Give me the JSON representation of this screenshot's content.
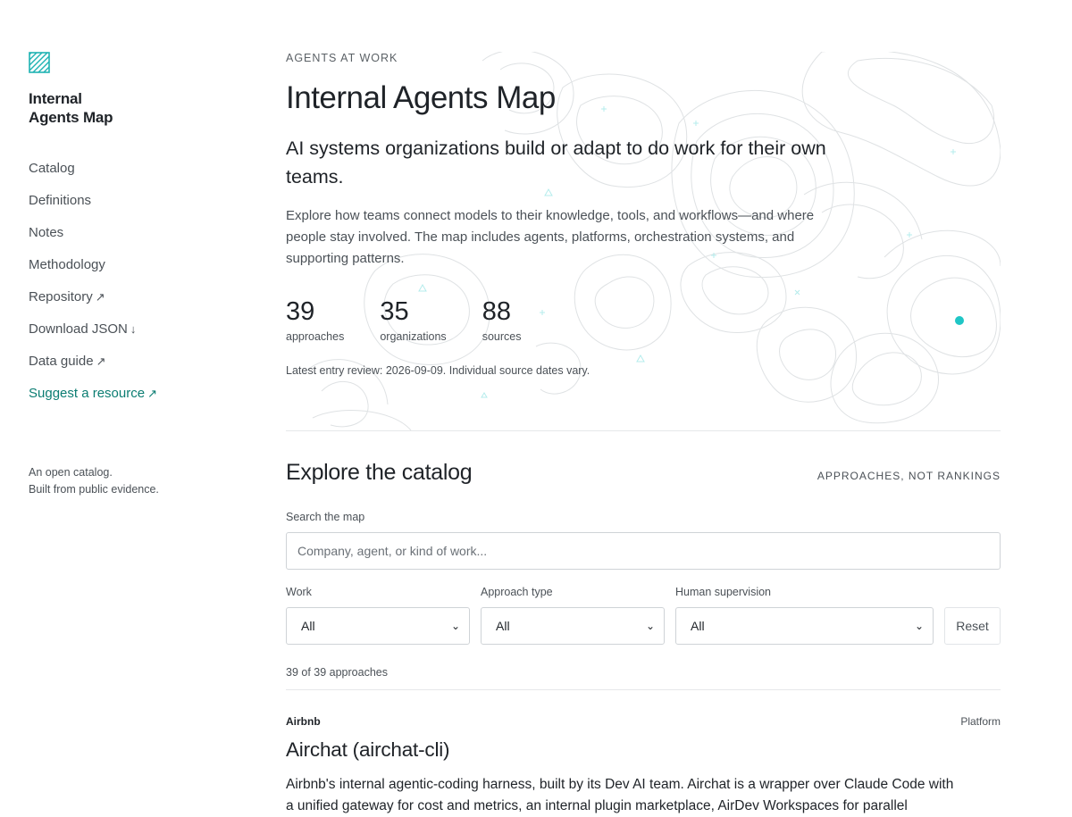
{
  "sidebar": {
    "logo_icon": "diagonal-hatch-square-icon",
    "brand_line1": "Internal",
    "brand_line2": "Agents Map",
    "nav": [
      {
        "label": "Catalog",
        "arrow": ""
      },
      {
        "label": "Definitions",
        "arrow": ""
      },
      {
        "label": "Notes",
        "arrow": ""
      },
      {
        "label": "Methodology",
        "arrow": ""
      },
      {
        "label": "Repository",
        "arrow": "↗"
      },
      {
        "label": "Download JSON",
        "arrow": "↓"
      },
      {
        "label": "Data guide",
        "arrow": "↗"
      },
      {
        "label": "Suggest a resource",
        "arrow": "↗"
      }
    ],
    "footer_line1": "An open catalog.",
    "footer_line2": "Built from public evidence."
  },
  "hero": {
    "eyebrow": "AGENTS AT WORK",
    "title": "Internal Agents Map",
    "lead": "AI systems organizations build or adapt to do work for their own teams.",
    "description": "Explore how teams connect models to their knowledge, tools, and workflows—and where people stay involved. The map includes agents, platforms, orchestration systems, and supporting patterns.",
    "stats": [
      {
        "number": "39",
        "label": "approaches"
      },
      {
        "number": "35",
        "label": "organizations"
      },
      {
        "number": "88",
        "label": "sources"
      }
    ],
    "review": "Latest entry review: 2026-09-09. Individual source dates vary."
  },
  "catalog": {
    "title": "Explore the catalog",
    "note": "APPROACHES, NOT RANKINGS",
    "search_label": "Search the map",
    "search_placeholder": "Company, agent, or kind of work...",
    "filters": [
      {
        "label": "Work",
        "value": "All"
      },
      {
        "label": "Approach type",
        "value": "All"
      },
      {
        "label": "Human supervision",
        "value": "All"
      }
    ],
    "reset_label": "Reset",
    "count_text": "39 of 39 approaches"
  },
  "entry": {
    "org": "Airbnb",
    "type": "Platform",
    "title": "Airchat (airchat-cli)",
    "description": "Airbnb's internal agentic-coding harness, built by its Dev AI team. Airchat is a wrapper over Claude Code with a unified gateway for cost and metrics, an internal plugin marketplace, AirDev Workspaces for parallel"
  },
  "colors": {
    "accent": "#0b7d72",
    "map_accent": "#1fc6c6",
    "contour": "#dfe2e4"
  }
}
